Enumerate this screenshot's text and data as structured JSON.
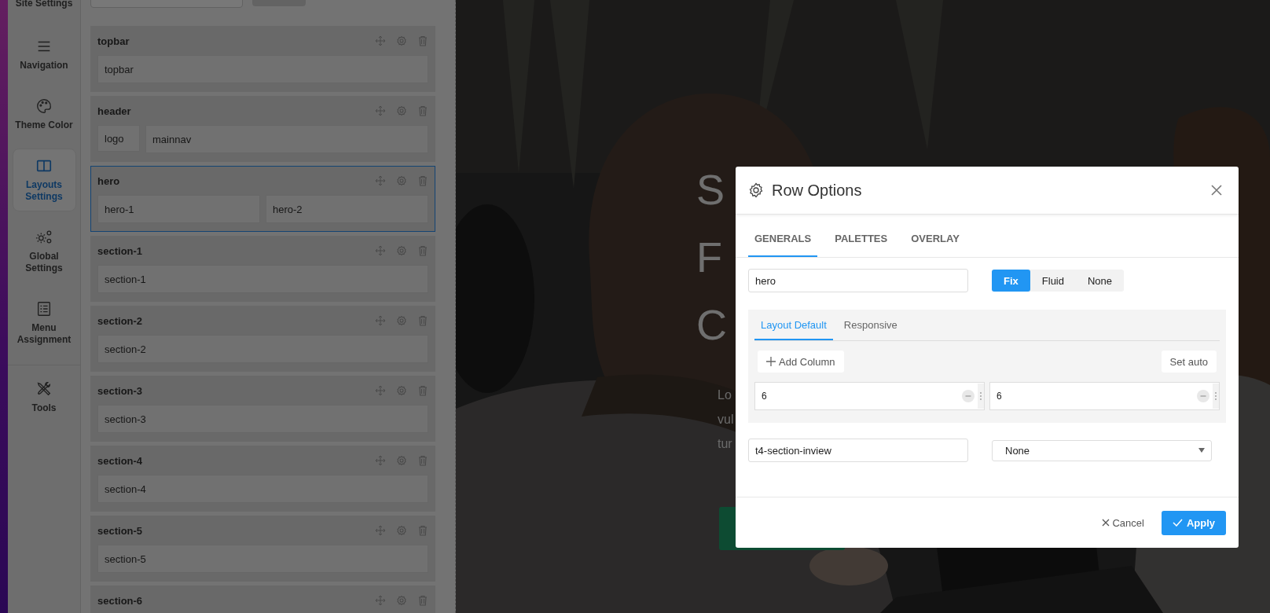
{
  "sidebar": {
    "items": [
      {
        "label": "Site Settings",
        "kind": "none",
        "selected": false
      },
      {
        "label": "Navigation",
        "kind": "menu",
        "selected": false
      },
      {
        "label": "Theme Color",
        "kind": "palette",
        "selected": false
      },
      {
        "label": "Layouts Settings",
        "kind": "columns",
        "selected": true
      },
      {
        "label": "Global Settings",
        "kind": "gears",
        "selected": false
      },
      {
        "label": "Menu Assignment",
        "kind": "checklist",
        "selected": false
      }
    ],
    "bottom_items": [
      {
        "label": "Tools",
        "kind": "tools",
        "selected": false
      }
    ]
  },
  "layout_rows": [
    {
      "name": "topbar",
      "selected": false,
      "columns": [
        "topbar"
      ]
    },
    {
      "name": "header",
      "selected": false,
      "columns": [
        "logo",
        "mainnav"
      ]
    },
    {
      "name": "hero",
      "selected": true,
      "columns": [
        "hero-1",
        "hero-2"
      ]
    },
    {
      "name": "section-1",
      "selected": false,
      "columns": [
        "section-1"
      ]
    },
    {
      "name": "section-2",
      "selected": false,
      "columns": [
        "section-2"
      ]
    },
    {
      "name": "section-3",
      "selected": false,
      "columns": [
        "section-3"
      ]
    },
    {
      "name": "section-4",
      "selected": false,
      "columns": [
        "section-4"
      ]
    },
    {
      "name": "section-5",
      "selected": false,
      "columns": [
        "section-5"
      ]
    },
    {
      "name": "section-6",
      "selected": false
    }
  ],
  "preview": {
    "heading_lines": [
      "S",
      "F",
      "C"
    ],
    "paragraph_lines": [
      "Lo",
      "vul",
      "tur"
    ]
  },
  "dialog": {
    "title": "Row Options",
    "tabs": [
      {
        "label": "GENERALS",
        "selected": true
      },
      {
        "label": "PALETTES",
        "selected": false
      },
      {
        "label": "OVERLAY",
        "selected": false
      }
    ],
    "name_field": {
      "value": "hero"
    },
    "container_options": [
      {
        "label": "Fix",
        "selected": true
      },
      {
        "label": "Fluid",
        "selected": false
      },
      {
        "label": "None",
        "selected": false
      }
    ],
    "layout_tabs": [
      {
        "label": "Layout Default",
        "selected": true
      },
      {
        "label": "Responsive",
        "selected": false
      }
    ],
    "add_column": "Add Column",
    "set_auto": "Set auto",
    "columns": [
      {
        "value": "6"
      },
      {
        "value": "6"
      }
    ],
    "class_field": {
      "value": "t4-section-inview"
    },
    "animation_select": {
      "value": "None"
    },
    "cancel": "Cancel",
    "apply": "Apply"
  }
}
